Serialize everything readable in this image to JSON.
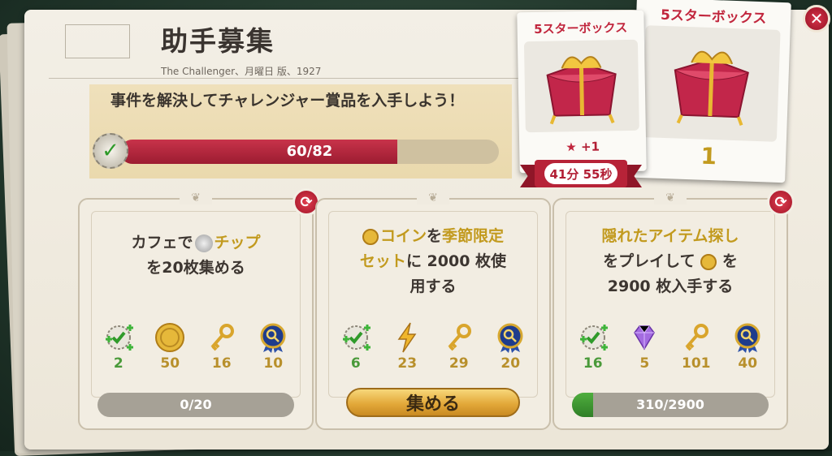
{
  "header": {
    "title": "助手募集",
    "subtitle": "The Challenger、月曜日 版、1927"
  },
  "challenge": {
    "description": "事件を解決してチャレンジャー賞品を入手しよう！",
    "progress_label": "60/82",
    "progress_fraction": 0.7317
  },
  "tasks": [
    {
      "line1_a": "カフェで",
      "line1_b": "チップ",
      "line2": "を20枚集める",
      "rewards": [
        {
          "icon": "badge-plus-icon",
          "value": "2"
        },
        {
          "icon": "gold-coin-icon",
          "value": "50"
        },
        {
          "icon": "gold-key-icon",
          "value": "16"
        },
        {
          "icon": "magnifier-medal-icon",
          "value": "10"
        }
      ],
      "progress_label": "0/20",
      "progress_fraction": 0
    },
    {
      "line1_a": "コイン",
      "line1_b": "を",
      "line1_c": "季節限定",
      "line2_a": "セット",
      "line2_b": "に 2000 枚使",
      "line3": "用する",
      "rewards": [
        {
          "icon": "badge-plus-icon",
          "value": "6"
        },
        {
          "icon": "lightning-icon",
          "value": "23"
        },
        {
          "icon": "gold-key-icon",
          "value": "29"
        },
        {
          "icon": "magnifier-medal-icon",
          "value": "20"
        }
      ],
      "button_label": "集める"
    },
    {
      "line1": "隠れたアイテム探し",
      "line2_a": "をプレイして",
      "line2_b": "を",
      "line3": "2900 枚入手する",
      "rewards": [
        {
          "icon": "badge-plus-icon",
          "value": "16"
        },
        {
          "icon": "purple-gem-icon",
          "value": "5"
        },
        {
          "icon": "gold-key-icon",
          "value": "101"
        },
        {
          "icon": "magnifier-medal-icon",
          "value": "40"
        }
      ],
      "progress_label": "310/2900",
      "progress_fraction": 0.1069
    }
  ],
  "reward_boxes": {
    "current": {
      "title": "5スターボックス",
      "bonus": "+1",
      "timer": "41分 55秒"
    },
    "next": {
      "title": "5スターボックス",
      "count": "1"
    }
  },
  "colors": {
    "accent_red": "#c1263d",
    "gold": "#c29a1e",
    "green": "#4a9a3a"
  }
}
